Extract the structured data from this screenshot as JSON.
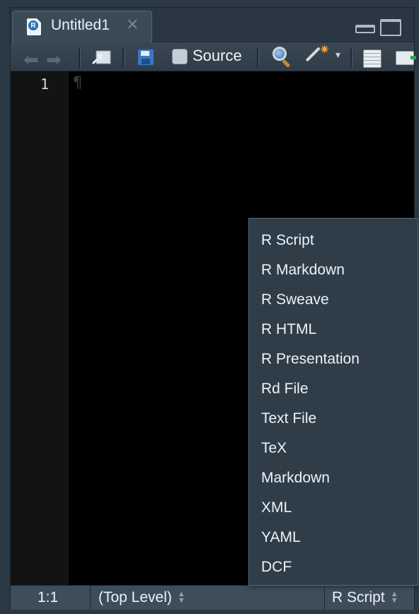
{
  "tab": {
    "title": "Untitled1",
    "close_glyph": "×",
    "icon": "r-script-file-icon",
    "icon_letter": "R"
  },
  "window_controls": {
    "minimize": "minimize-icon",
    "maximize": "maximize-icon"
  },
  "toolbar": {
    "back": "back-arrow-icon",
    "forward": "forward-arrow-icon",
    "source_on_save_label": "Source",
    "icons": [
      "back-arrow-icon",
      "forward-arrow-icon",
      "show-in-new-window-icon",
      "save-icon",
      "search-icon",
      "code-tools-wand-icon",
      "compile-notebook-icon",
      "outline-icon"
    ]
  },
  "editor": {
    "line_numbers": [
      "1"
    ],
    "content_marker": "¶"
  },
  "status_bar": {
    "position": "1:1",
    "scope": "(Top Level)",
    "file_type": "R Script"
  },
  "file_type_menu": {
    "items": [
      "R Script",
      "R Markdown",
      "R Sweave",
      "R HTML",
      "R Presentation",
      "Rd File",
      "Text File",
      "TeX",
      "Markdown",
      "XML",
      "YAML",
      "DCF"
    ]
  },
  "colors": {
    "editor_bg": "#000000",
    "chrome_bg": "#2e3c48",
    "save_blue": "#3d76c2",
    "wand_gold": "#f2a623"
  }
}
